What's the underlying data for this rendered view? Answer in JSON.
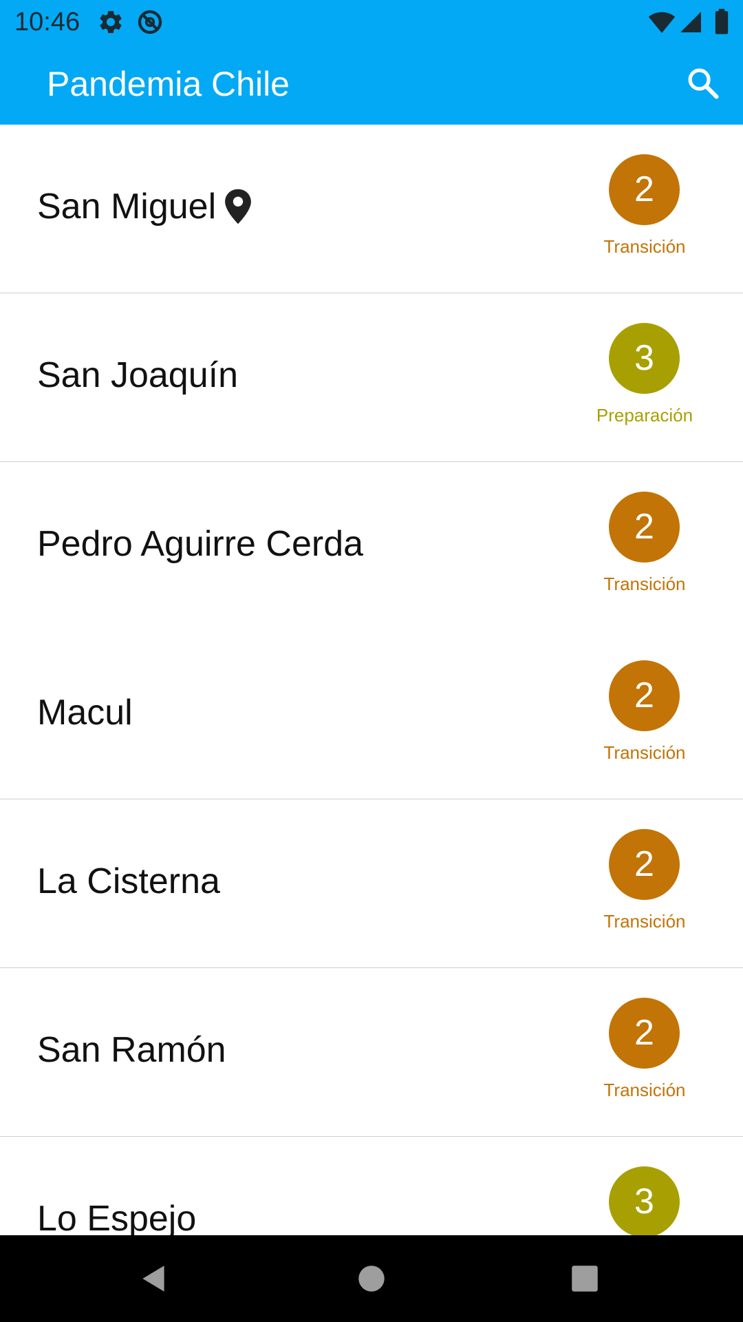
{
  "status_bar": {
    "time": "10:46",
    "icons": [
      "settings-icon",
      "sync-icon",
      "wifi-icon",
      "signal-icon",
      "battery-icon"
    ]
  },
  "app_bar": {
    "title": "Pandemia Chile",
    "search_icon": "search-icon",
    "color": "#03A9F4"
  },
  "phase_colors": {
    "Transición": "#C27406",
    "Preparación": "#A8A002"
  },
  "list": {
    "items": [
      {
        "name": "San Miguel",
        "has_location_pin": true,
        "phase_number": "2",
        "phase_label": "Transición",
        "color": "#C27406"
      },
      {
        "name": "San Joaquín",
        "has_location_pin": false,
        "phase_number": "3",
        "phase_label": "Preparación",
        "color": "#A8A002"
      },
      {
        "name": "Pedro Aguirre Cerda",
        "has_location_pin": false,
        "phase_number": "2",
        "phase_label": "Transición",
        "color": "#C27406"
      },
      {
        "name": "Macul",
        "has_location_pin": false,
        "phase_number": "2",
        "phase_label": "Transición",
        "color": "#C27406"
      },
      {
        "name": "La Cisterna",
        "has_location_pin": false,
        "phase_number": "2",
        "phase_label": "Transición",
        "color": "#C27406"
      },
      {
        "name": "San Ramón",
        "has_location_pin": false,
        "phase_number": "2",
        "phase_label": "Transición",
        "color": "#C27406"
      },
      {
        "name": "Lo Espejo",
        "has_location_pin": false,
        "phase_number": "3",
        "phase_label": "",
        "color": "#A8A002"
      }
    ]
  },
  "nav_bar": {
    "icons": [
      "back-icon",
      "home-icon",
      "recents-icon"
    ]
  }
}
